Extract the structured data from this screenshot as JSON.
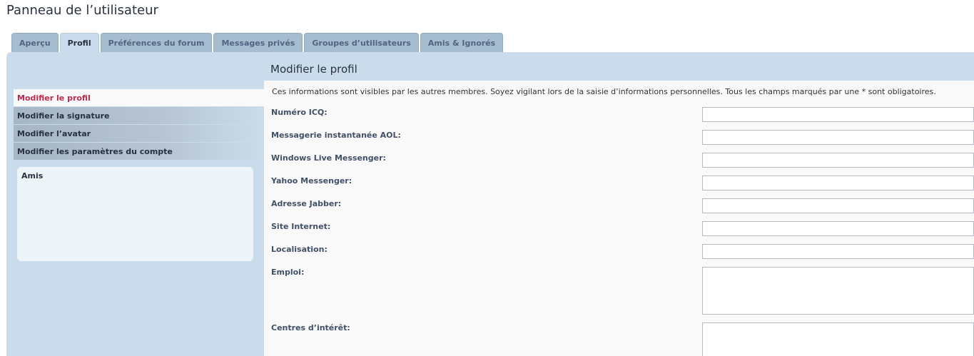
{
  "header": {
    "title": "Panneau de l’utilisateur"
  },
  "tabs": [
    {
      "label": "Aperçu",
      "active": false
    },
    {
      "label": "Profil",
      "active": true
    },
    {
      "label": "Préférences du forum",
      "active": false
    },
    {
      "label": "Messages privés",
      "active": false
    },
    {
      "label": "Groupes d’utilisateurs",
      "active": false
    },
    {
      "label": "Amis & Ignorés",
      "active": false
    }
  ],
  "sidebar": {
    "items": [
      {
        "label": "Modifier le profil",
        "active": true
      },
      {
        "label": "Modifier la signature",
        "active": false
      },
      {
        "label": "Modifier l’avatar",
        "active": false
      },
      {
        "label": "Modifier les paramètres du compte",
        "active": false
      }
    ],
    "friends": {
      "title": "Amis"
    }
  },
  "main": {
    "title": "Modifier le profil",
    "intro": "Ces informations sont visibles par les autres membres. Soyez vigilant lors de la saisie d’informations personnelles. Tous les champs marqués par une * sont obligatoires.",
    "fields": [
      {
        "label": "Numéro ICQ:",
        "value": ""
      },
      {
        "label": "Messagerie instantanée AOL:",
        "value": ""
      },
      {
        "label": "Windows Live Messenger:",
        "value": ""
      },
      {
        "label": "Yahoo Messenger:",
        "value": ""
      },
      {
        "label": "Adresse Jabber:",
        "value": ""
      },
      {
        "label": "Site Internet:",
        "value": ""
      },
      {
        "label": "Localisation:",
        "value": ""
      },
      {
        "label": "Emploi:",
        "value": ""
      },
      {
        "label": "Centres d’intérêt:",
        "value": ""
      }
    ]
  },
  "colors": {
    "accent": "#bc2a4d",
    "panel": "#cadceb",
    "tab": "#a6bccf",
    "content": "#f9f9f9",
    "text": "#28313f"
  }
}
